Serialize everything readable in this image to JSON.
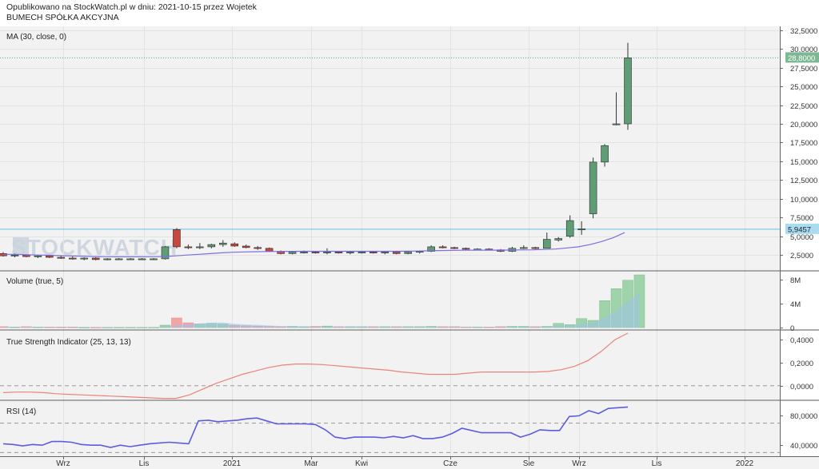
{
  "header": {
    "line1": "Opublikowano na StockWatch.pl w dniu: 2021-10-15 przez Wojetek",
    "line2": "BUMECH SPÓŁKA AKCYJNA"
  },
  "watermark": "STOCKWATCH",
  "panels": {
    "price_label": "MA (30, close, 0)",
    "volume_label": "Volume (true, 5)",
    "tsi_label": "True Strength Indicator (25, 13, 13)",
    "rsi_label": "RSI (14)"
  },
  "colors": {
    "up": "#5f9e75",
    "down": "#c9473f",
    "ma": "#7b6fe0",
    "tsi": "#e9837c",
    "rsi": "#5c5ce0",
    "price_line": "#5f9e8a",
    "hline": "#63c1e6",
    "vol_up": "#9fd3a9",
    "vol_down": "#f2a5a5",
    "bg": "#f2f2f2"
  },
  "chart_data": [
    {
      "type": "candlestick",
      "panel": "price",
      "title": "MA (30, close, 0)",
      "x_axis": [
        "Wrz",
        "Lis",
        "2021",
        "Mar",
        "Kwi",
        "Cze",
        "Sie",
        "Wrz",
        "Lis",
        "2022"
      ],
      "y_ticks": [
        "2,5000",
        "5,0000",
        "7,5000",
        "10,0000",
        "12,5000",
        "15,0000",
        "17,5000",
        "20,0000",
        "22,5000",
        "25,0000",
        "27,5000",
        "30,0000",
        "32,5000"
      ],
      "ylim": [
        0.5,
        33
      ],
      "last_price_label": "28,8000",
      "last_price": 28.8,
      "horizontal_line_label": "5,9457",
      "horizontal_line": 5.9457,
      "candles": [
        {
          "o": 2.7,
          "h": 2.9,
          "l": 2.3,
          "c": 2.4
        },
        {
          "o": 2.4,
          "h": 2.7,
          "l": 2.2,
          "c": 2.5
        },
        {
          "o": 2.5,
          "h": 2.6,
          "l": 2.2,
          "c": 2.3
        },
        {
          "o": 2.3,
          "h": 2.5,
          "l": 2.1,
          "c": 2.4
        },
        {
          "o": 2.4,
          "h": 2.5,
          "l": 2.1,
          "c": 2.2
        },
        {
          "o": 2.2,
          "h": 2.4,
          "l": 2.0,
          "c": 2.1
        },
        {
          "o": 2.1,
          "h": 2.3,
          "l": 1.9,
          "c": 2.0
        },
        {
          "o": 2.0,
          "h": 2.2,
          "l": 1.8,
          "c": 2.1
        },
        {
          "o": 2.1,
          "h": 2.2,
          "l": 1.8,
          "c": 1.9
        },
        {
          "o": 1.9,
          "h": 2.1,
          "l": 1.8,
          "c": 2.0
        },
        {
          "o": 2.0,
          "h": 2.1,
          "l": 1.9,
          "c": 2.0
        },
        {
          "o": 2.0,
          "h": 2.1,
          "l": 1.9,
          "c": 2.0
        },
        {
          "o": 2.0,
          "h": 2.1,
          "l": 1.9,
          "c": 2.0
        },
        {
          "o": 2.0,
          "h": 2.1,
          "l": 1.9,
          "c": 2.0
        },
        {
          "o": 2.0,
          "h": 3.7,
          "l": 1.9,
          "c": 3.6
        },
        {
          "o": 5.9,
          "h": 6.1,
          "l": 3.4,
          "c": 3.6
        },
        {
          "o": 3.6,
          "h": 3.9,
          "l": 3.3,
          "c": 3.5
        },
        {
          "o": 3.5,
          "h": 4.1,
          "l": 3.3,
          "c": 3.6
        },
        {
          "o": 3.6,
          "h": 4.0,
          "l": 3.4,
          "c": 3.9
        },
        {
          "o": 3.9,
          "h": 4.5,
          "l": 3.6,
          "c": 4.1
        },
        {
          "o": 4.0,
          "h": 4.2,
          "l": 3.6,
          "c": 3.7
        },
        {
          "o": 3.7,
          "h": 3.9,
          "l": 3.4,
          "c": 3.5
        },
        {
          "o": 3.5,
          "h": 3.7,
          "l": 3.2,
          "c": 3.4
        },
        {
          "o": 3.4,
          "h": 3.5,
          "l": 2.9,
          "c": 3.0
        },
        {
          "o": 3.0,
          "h": 3.1,
          "l": 2.6,
          "c": 2.7
        },
        {
          "o": 2.7,
          "h": 3.0,
          "l": 2.6,
          "c": 2.9
        },
        {
          "o": 2.9,
          "h": 3.1,
          "l": 2.7,
          "c": 2.9
        },
        {
          "o": 2.9,
          "h": 3.0,
          "l": 2.7,
          "c": 2.8
        },
        {
          "o": 2.8,
          "h": 3.4,
          "l": 2.6,
          "c": 2.9
        },
        {
          "o": 2.9,
          "h": 3.0,
          "l": 2.7,
          "c": 2.8
        },
        {
          "o": 2.8,
          "h": 3.0,
          "l": 2.6,
          "c": 2.9
        },
        {
          "o": 2.9,
          "h": 3.0,
          "l": 2.7,
          "c": 2.9
        },
        {
          "o": 2.9,
          "h": 3.0,
          "l": 2.7,
          "c": 2.8
        },
        {
          "o": 2.8,
          "h": 3.0,
          "l": 2.6,
          "c": 2.9
        },
        {
          "o": 2.9,
          "h": 3.0,
          "l": 2.6,
          "c": 2.7
        },
        {
          "o": 2.7,
          "h": 3.0,
          "l": 2.6,
          "c": 2.9
        },
        {
          "o": 2.9,
          "h": 3.1,
          "l": 2.7,
          "c": 3.0
        },
        {
          "o": 3.0,
          "h": 3.8,
          "l": 2.9,
          "c": 3.6
        },
        {
          "o": 3.6,
          "h": 3.8,
          "l": 3.4,
          "c": 3.5
        },
        {
          "o": 3.5,
          "h": 3.6,
          "l": 3.3,
          "c": 3.4
        },
        {
          "o": 3.4,
          "h": 3.5,
          "l": 3.2,
          "c": 3.3
        },
        {
          "o": 3.3,
          "h": 3.4,
          "l": 3.2,
          "c": 3.3
        },
        {
          "o": 3.3,
          "h": 3.4,
          "l": 3.1,
          "c": 3.2
        },
        {
          "o": 3.2,
          "h": 3.3,
          "l": 2.9,
          "c": 3.0
        },
        {
          "o": 3.0,
          "h": 3.6,
          "l": 2.9,
          "c": 3.4
        },
        {
          "o": 3.4,
          "h": 3.8,
          "l": 3.3,
          "c": 3.5
        },
        {
          "o": 3.5,
          "h": 3.6,
          "l": 3.3,
          "c": 3.4
        },
        {
          "o": 3.4,
          "h": 5.5,
          "l": 3.4,
          "c": 4.6
        },
        {
          "o": 4.5,
          "h": 4.9,
          "l": 4.3,
          "c": 4.7
        },
        {
          "o": 5.0,
          "h": 7.8,
          "l": 4.8,
          "c": 7.1
        },
        {
          "o": 6.0,
          "h": 7.0,
          "l": 5.2,
          "c": 6.0
        },
        {
          "o": 8.0,
          "h": 15.5,
          "l": 7.4,
          "c": 14.9
        },
        {
          "o": 14.9,
          "h": 17.3,
          "l": 14.3,
          "c": 17.1
        },
        {
          "o": 20.0,
          "h": 24.2,
          "l": 19.8,
          "c": 20.0
        },
        {
          "o": 20.0,
          "h": 30.8,
          "l": 19.2,
          "c": 28.8
        }
      ],
      "ma": [
        2.6,
        2.6,
        2.55,
        2.5,
        2.47,
        2.42,
        2.38,
        2.35,
        2.3,
        2.28,
        2.27,
        2.27,
        2.27,
        2.28,
        2.3,
        2.4,
        2.5,
        2.6,
        2.7,
        2.8,
        2.88,
        2.92,
        2.95,
        2.97,
        2.98,
        2.99,
        3.0,
        3.0,
        3.0,
        3.0,
        3.0,
        3.0,
        3.0,
        3.0,
        3.0,
        3.02,
        3.04,
        3.07,
        3.1,
        3.12,
        3.14,
        3.15,
        3.15,
        3.15,
        3.16,
        3.18,
        3.2,
        3.25,
        3.3,
        3.45,
        3.6,
        3.9,
        4.3,
        4.8,
        5.5
      ]
    },
    {
      "type": "bar",
      "panel": "volume",
      "title": "Volume (true, 5)",
      "y_ticks": [
        "0",
        "4M",
        "8M"
      ],
      "ylim": [
        0,
        8.8
      ],
      "unit": "M",
      "values": [
        0.15,
        0.1,
        0.15,
        0.1,
        0.1,
        0.1,
        0.1,
        0.05,
        0.05,
        0.05,
        0.05,
        0.05,
        0.05,
        0.05,
        0.4,
        1.6,
        0.8,
        0.6,
        0.7,
        0.6,
        0.4,
        0.3,
        0.25,
        0.2,
        0.15,
        0.2,
        0.15,
        0.2,
        0.25,
        0.15,
        0.15,
        0.15,
        0.15,
        0.15,
        0.15,
        0.15,
        0.15,
        0.2,
        0.15,
        0.15,
        0.1,
        0.1,
        0.1,
        0.15,
        0.2,
        0.2,
        0.15,
        0.2,
        0.7,
        0.5,
        1.5,
        1.2,
        4.5,
        6.5,
        7.9,
        8.8
      ]
    },
    {
      "type": "line",
      "panel": "tsi",
      "title": "True Strength Indicator (25, 13, 13)",
      "y_ticks": [
        "0,0000",
        "0,2000",
        "0,4000"
      ],
      "ylim": [
        -0.12,
        0.48
      ],
      "dashed_level": 0,
      "values": [
        -0.06,
        -0.055,
        -0.055,
        -0.06,
        -0.07,
        -0.075,
        -0.08,
        -0.085,
        -0.09,
        -0.095,
        -0.1,
        -0.105,
        -0.11,
        -0.11,
        -0.08,
        -0.03,
        0.02,
        0.06,
        0.1,
        0.13,
        0.16,
        0.18,
        0.19,
        0.19,
        0.185,
        0.175,
        0.165,
        0.155,
        0.145,
        0.135,
        0.12,
        0.11,
        0.1,
        0.1,
        0.1,
        0.11,
        0.12,
        0.12,
        0.12,
        0.12,
        0.12,
        0.125,
        0.14,
        0.17,
        0.22,
        0.3,
        0.4,
        0.46
      ]
    },
    {
      "type": "line",
      "panel": "rsi",
      "title": "RSI (14)",
      "y_ticks": [
        "40,0000",
        "80,0000"
      ],
      "ylim": [
        25,
        100
      ],
      "dashed_levels": [
        30,
        70
      ],
      "values": [
        42,
        41,
        39,
        41,
        40,
        45,
        45,
        44,
        41,
        40,
        40,
        37,
        40,
        38,
        40,
        42,
        43,
        44,
        43,
        42,
        73,
        74,
        72,
        73,
        74,
        76,
        77,
        73,
        69,
        69,
        69,
        69,
        68,
        61,
        51,
        49,
        51,
        51,
        51,
        50,
        52,
        50,
        53,
        49,
        49,
        51,
        56,
        63,
        60,
        57,
        57,
        57,
        57,
        51,
        55,
        61,
        60,
        60,
        79,
        80,
        87,
        83,
        90,
        91,
        92
      ]
    }
  ]
}
